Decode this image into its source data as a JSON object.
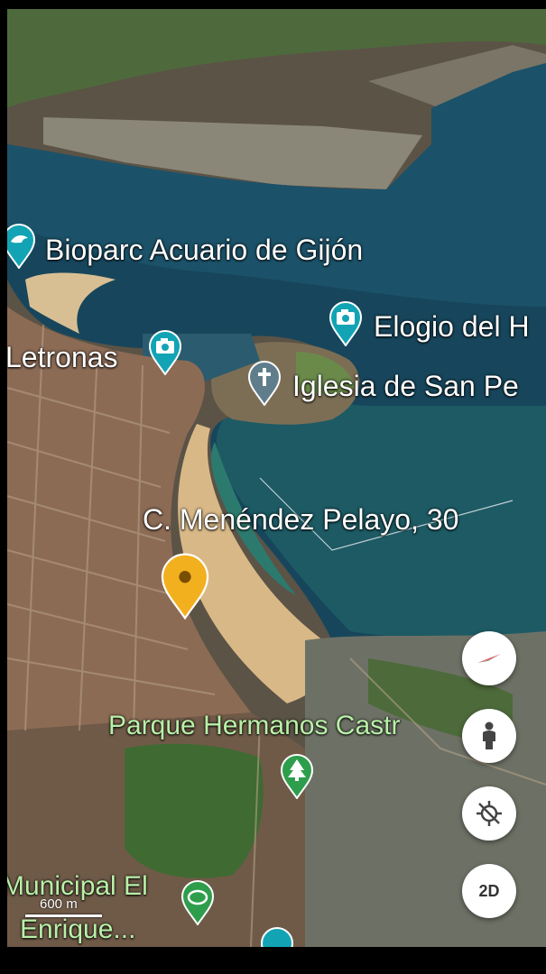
{
  "map": {
    "places": [
      {
        "label": "Bioparc Acuario de Gijón",
        "icon": "dolphin-icon",
        "color": "#12a4b4"
      },
      {
        "label": "Elogio del H",
        "icon": "camera-icon",
        "color": "#12a4b4"
      },
      {
        "label": "Letronas",
        "icon": "camera-icon",
        "color": "#12a4b4"
      },
      {
        "label": "Iglesia de San Pe",
        "icon": "cross-icon",
        "color": "#607d8b"
      },
      {
        "label": "C. Menéndez Pelayo, 30",
        "icon": "location-marker-icon",
        "color": "#f2b01e"
      },
      {
        "label": "Parque Hermanos Castr",
        "icon": "tree-icon",
        "color": "#2e9e4c"
      },
      {
        "label": "Municipal El",
        "icon": "stadium-icon",
        "color": "#2e9e4c"
      },
      {
        "label": "Enrique...",
        "icon": "",
        "color": ""
      }
    ],
    "scale": "600 m"
  },
  "controls": {
    "compass_icon": "compass-icon",
    "street_view_icon": "pegman-icon",
    "my_location_icon": "location-off-icon",
    "view_mode_label": "2D"
  }
}
